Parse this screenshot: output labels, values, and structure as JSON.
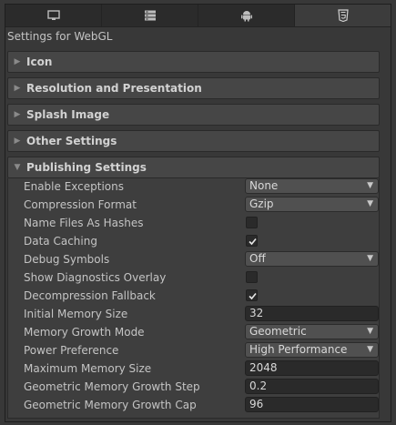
{
  "tabs": [
    {
      "icon": "monitor-icon",
      "active": false
    },
    {
      "icon": "server-icon",
      "active": false
    },
    {
      "icon": "android-icon",
      "active": false
    },
    {
      "icon": "html5-icon",
      "active": true
    }
  ],
  "header": {
    "title": "Settings for WebGL"
  },
  "sections": [
    {
      "label": "Icon",
      "expanded": false
    },
    {
      "label": "Resolution and Presentation",
      "expanded": false
    },
    {
      "label": "Splash Image",
      "expanded": false
    },
    {
      "label": "Other Settings",
      "expanded": false
    },
    {
      "label": "Publishing Settings",
      "expanded": true
    }
  ],
  "publishing": {
    "enable_exceptions": {
      "label": "Enable Exceptions",
      "value": "None"
    },
    "compression_format": {
      "label": "Compression Format",
      "value": "Gzip"
    },
    "name_files_as_hashes": {
      "label": "Name Files As Hashes",
      "checked": false
    },
    "data_caching": {
      "label": "Data Caching",
      "checked": true
    },
    "debug_symbols": {
      "label": "Debug Symbols",
      "value": "Off"
    },
    "show_diagnostics_overlay": {
      "label": "Show Diagnostics Overlay",
      "checked": false
    },
    "decompression_fallback": {
      "label": "Decompression Fallback",
      "checked": true
    },
    "initial_memory_size": {
      "label": "Initial Memory Size",
      "value": "32"
    },
    "memory_growth_mode": {
      "label": "Memory Growth Mode",
      "value": "Geometric"
    },
    "power_preference": {
      "label": "Power Preference",
      "value": "High Performance"
    },
    "maximum_memory_size": {
      "label": "Maximum Memory Size",
      "value": "2048"
    },
    "geometric_memory_growth_step": {
      "label": "Geometric Memory Growth Step",
      "value": "0.2"
    },
    "geometric_memory_growth_cap": {
      "label": "Geometric Memory Growth Cap",
      "value": "96"
    }
  },
  "colors": {
    "background": "#383838",
    "section_header": "#464646",
    "field": "#2a2a2a",
    "dropdown": "#505050"
  }
}
